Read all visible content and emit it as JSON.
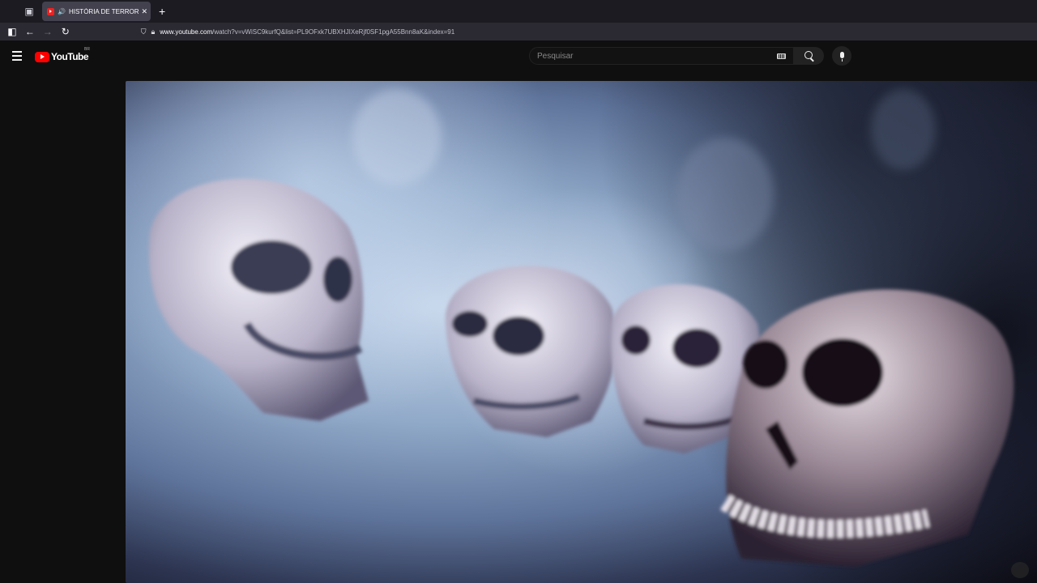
{
  "browser": {
    "tab": {
      "title": "HISTÓRIA DE TERROR : O M"
    },
    "url": {
      "domain": "www.youtube.com",
      "rest": "/watch?v=vWiSC9kurfQ&list=PL9OFxk7UBXHJIXeRjf0SF1pgA55Bnn8aK&index=91"
    }
  },
  "youtube": {
    "logo_text": "YouTube",
    "region": "BR",
    "search_placeholder": "Pesquisar"
  },
  "colors": {
    "brand_red": "#ff0000",
    "page_bg": "#0f0f0f",
    "tab_active": "#42414d"
  }
}
